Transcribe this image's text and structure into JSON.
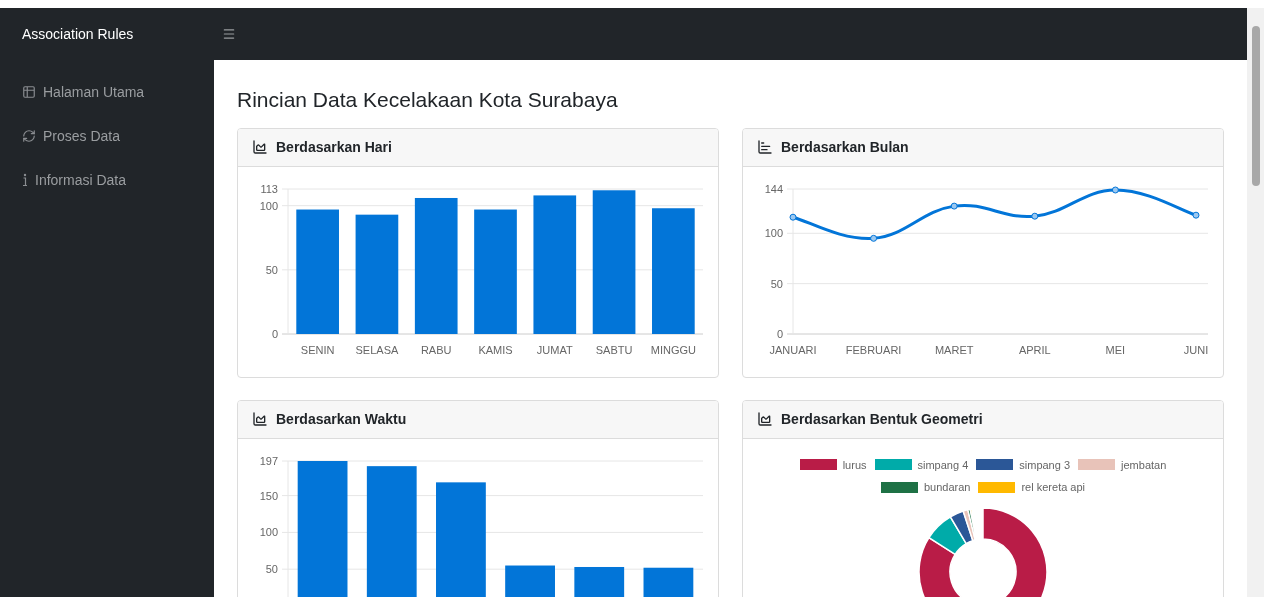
{
  "brand": "Association Rules",
  "sidebar": {
    "items": [
      {
        "label": "Halaman Utama"
      },
      {
        "label": "Proses Data"
      },
      {
        "label": "Informasi Data"
      }
    ]
  },
  "page_title": "Rincian Data Kecelakaan Kota Surabaya",
  "cards": [
    {
      "title": "Berdasarkan Hari",
      "kind": "chart",
      "chart_data": {
        "type": "bar",
        "categories": [
          "SENIN",
          "SELASA",
          "RABU",
          "KAMIS",
          "JUMAT",
          "SABTU",
          "MINGGU"
        ],
        "series": [
          {
            "color": "#0275d8",
            "values": [
              97,
              93,
              106,
              97,
              108,
              112,
              98
            ]
          }
        ],
        "ylim": [
          0,
          113
        ],
        "yticks": [
          0,
          50,
          100,
          113
        ],
        "grid": true
      }
    },
    {
      "title": "Berdasarkan Bulan",
      "kind": "chart",
      "chart_data": {
        "type": "line",
        "categories": [
          "JANUARI",
          "FEBRUARI",
          "MARET",
          "APRIL",
          "MEI",
          "JUNI"
        ],
        "series": [
          {
            "color": "#0275d8",
            "marker": true,
            "values": [
              116,
              95,
              127,
              117,
              143,
              118
            ]
          }
        ],
        "ylim": [
          0,
          144
        ],
        "yticks": [
          0,
          50,
          100,
          144
        ],
        "grid": true
      }
    },
    {
      "title": "Berdasarkan Waktu",
      "kind": "chart",
      "chart_data": {
        "type": "bar",
        "series": [
          {
            "color": "#0275d8",
            "values": [
              197,
              190,
              168,
              55,
              53,
              52
            ]
          }
        ],
        "ylim": [
          0,
          197
        ],
        "yticks": [
          50,
          100,
          150,
          197
        ],
        "grid": true
      }
    },
    {
      "title": "Berdasarkan Bentuk Geometri",
      "kind": "donut",
      "legend": [
        {
          "label": "lurus",
          "color": "#b91c47"
        },
        {
          "label": "simpang 4",
          "color": "#00aba9"
        },
        {
          "label": "simpang 3",
          "color": "#2b5797"
        },
        {
          "label": "jembatan",
          "color": "#e8c3b9"
        },
        {
          "label": "bundaran",
          "color": "#1e7145"
        },
        {
          "label": "rel kereta api",
          "color": "#ffb900"
        }
      ]
    }
  ]
}
